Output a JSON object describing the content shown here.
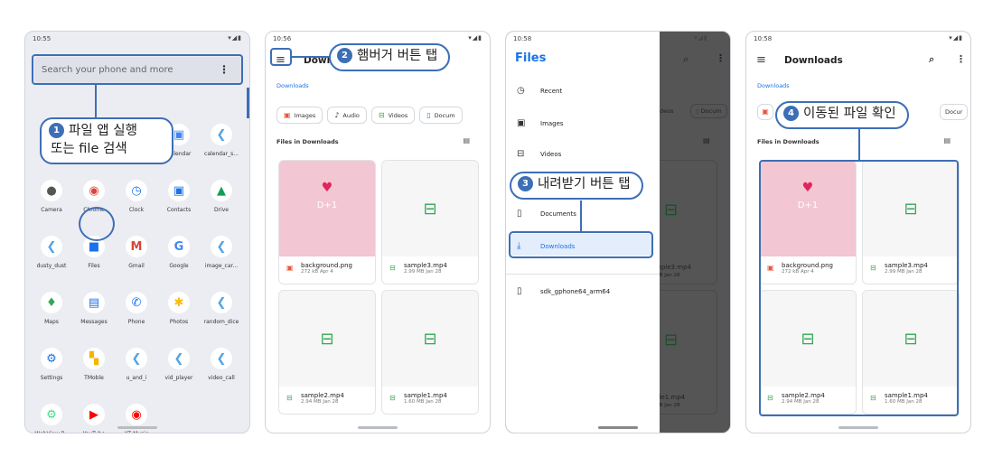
{
  "phone1": {
    "time": "10:55",
    "status_icons": "▾◢▮",
    "search_placeholder": "Search your phone and more",
    "menu_glyph": "⋮",
    "apps": [
      {
        "label": "",
        "glyph": "❮",
        "color": "#4fa3e6",
        "col": 0,
        "row": 0
      },
      {
        "label": "",
        "glyph": "❮",
        "color": "#4fa3e6",
        "col": 1,
        "row": 0
      },
      {
        "label": "",
        "glyph": "❮",
        "color": "#4fa3e6",
        "col": 2,
        "row": 0
      },
      {
        "label": "Calendar",
        "glyph": "▣",
        "color": "#4285f4",
        "col": 3,
        "row": 0
      },
      {
        "label": "calendar_s...",
        "glyph": "❮",
        "color": "#4fa3e6",
        "col": 4,
        "row": 0
      },
      {
        "label": "Camera",
        "glyph": "●",
        "color": "#555555",
        "col": 0,
        "row": 1
      },
      {
        "label": "Chrome",
        "glyph": "◉",
        "color": "#db4437",
        "col": 1,
        "row": 1
      },
      {
        "label": "Clock",
        "glyph": "◷",
        "color": "#1a73e8",
        "col": 2,
        "row": 1
      },
      {
        "label": "Contacts",
        "glyph": "▣",
        "color": "#1a73e8",
        "col": 3,
        "row": 1
      },
      {
        "label": "Drive",
        "glyph": "▲",
        "color": "#0f9d58",
        "col": 4,
        "row": 1
      },
      {
        "label": "dusty_dust",
        "glyph": "❮",
        "color": "#4fa3e6",
        "col": 0,
        "row": 2
      },
      {
        "label": "Files",
        "glyph": "■",
        "color": "#1a73e8",
        "col": 1,
        "row": 2
      },
      {
        "label": "Gmail",
        "glyph": "M",
        "color": "#db4437",
        "col": 2,
        "row": 2
      },
      {
        "label": "Google",
        "glyph": "G",
        "color": "#4285f4",
        "col": 3,
        "row": 2
      },
      {
        "label": "image_car...",
        "glyph": "❮",
        "color": "#4fa3e6",
        "col": 4,
        "row": 2
      },
      {
        "label": "Maps",
        "glyph": "♦",
        "color": "#34a853",
        "col": 0,
        "row": 3
      },
      {
        "label": "Messages",
        "glyph": "▤",
        "color": "#1a73e8",
        "col": 1,
        "row": 3
      },
      {
        "label": "Phone",
        "glyph": "✆",
        "color": "#1a73e8",
        "col": 2,
        "row": 3
      },
      {
        "label": "Photos",
        "glyph": "✱",
        "color": "#fbbc05",
        "col": 3,
        "row": 3
      },
      {
        "label": "random_dice",
        "glyph": "❮",
        "color": "#4fa3e6",
        "col": 4,
        "row": 3
      },
      {
        "label": "Settings",
        "glyph": "⚙",
        "color": "#1a73e8",
        "col": 0,
        "row": 4
      },
      {
        "label": "TMoble",
        "glyph": "▚",
        "color": "#f4b400",
        "col": 1,
        "row": 4
      },
      {
        "label": "u_and_i",
        "glyph": "❮",
        "color": "#4fa3e6",
        "col": 2,
        "row": 4
      },
      {
        "label": "vid_player",
        "glyph": "❮",
        "color": "#4fa3e6",
        "col": 3,
        "row": 4
      },
      {
        "label": "video_call",
        "glyph": "❮",
        "color": "#4fa3e6",
        "col": 4,
        "row": 4
      },
      {
        "label": "WebView B..",
        "glyph": "⚙",
        "color": "#3ddc84",
        "col": 0,
        "row": 5
      },
      {
        "label": "YouTube",
        "glyph": "▶",
        "color": "#ff0000",
        "col": 1,
        "row": 5
      },
      {
        "label": "YT Music",
        "glyph": "◉",
        "color": "#ff0000",
        "col": 2,
        "row": 5
      }
    ],
    "callout_num": "1",
    "callout_line1": "파일 앱 실행",
    "callout_line2": "또는 file 검색"
  },
  "phone2": {
    "time": "10:56",
    "status_icons": "▾◢▮",
    "title": "Downl",
    "breadcrumb": "Downloads",
    "chips": [
      {
        "label": "Images",
        "icon": "▣"
      },
      {
        "label": "Audio",
        "icon": "♪"
      },
      {
        "label": "Videos",
        "icon": "⊟"
      },
      {
        "label": "Docum",
        "icon": "▯"
      }
    ],
    "section": "Files in Downloads",
    "callout_num": "2",
    "callout_text": "햄버거 버튼 탭"
  },
  "phone3": {
    "time": "10:58",
    "status_icons": "▾◢▮",
    "drawer_title": "Files",
    "items": [
      {
        "label": "Recent",
        "icon": "◷"
      },
      {
        "label": "Images",
        "icon": "▣"
      },
      {
        "label": "Videos",
        "icon": "⊟"
      },
      {
        "label": "Documents",
        "icon": "▯"
      },
      {
        "label": "Downloads",
        "icon": "⤓"
      },
      {
        "label": "sdk_gphone64_arm64",
        "icon": "▯"
      }
    ],
    "bg_chip1": "deos",
    "bg_chip2": "Docum",
    "bg_card1": "mple3.mp4",
    "bg_card1_sub": "MB Jan 28",
    "bg_card2": "ple1.mp4",
    "bg_card2_sub": "MB Jan 28",
    "callout_num": "3",
    "callout_text": "내려받기 버튼 탭"
  },
  "phone4": {
    "time": "10:58",
    "status_icons": "▾◢▮",
    "title": "Downloads",
    "breadcrumb": "Downloads",
    "chip_partial": "Docur",
    "section": "Files in Downloads",
    "callout_num": "4",
    "callout_text": "이동된 파일 확인"
  },
  "files": [
    {
      "name": "background.png",
      "sub": "272 kB Apr 4",
      "type": "image"
    },
    {
      "name": "sample3.mp4",
      "sub": "2.99 MB Jan 28",
      "type": "video"
    },
    {
      "name": "sample2.mp4",
      "sub": "2.94 MB Jan 28",
      "type": "video"
    },
    {
      "name": "sample1.mp4",
      "sub": "1.60 MB Jan 28",
      "type": "video"
    }
  ],
  "thumb_text": "D+1",
  "icons": {
    "menu": "≡",
    "search": "⌕",
    "more": "⋮",
    "grid": "▤",
    "heart": "♥",
    "video": "⊟"
  },
  "accent": "#3d6fb6"
}
